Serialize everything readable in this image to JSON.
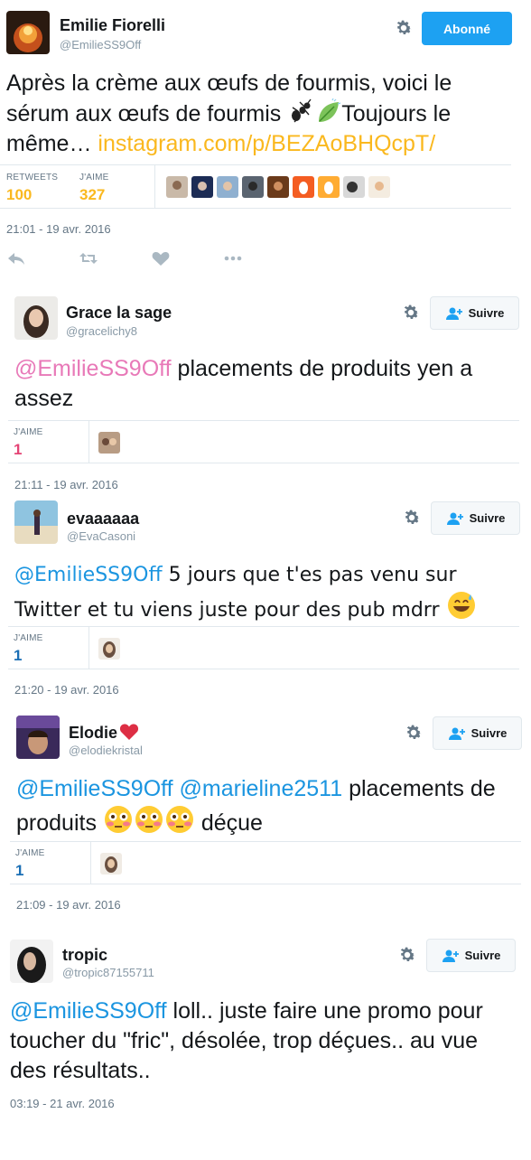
{
  "main_tweet": {
    "name": "Emilie Fiorelli",
    "handle": "@EmilieSS9Off",
    "follow_state_label": "Abonné",
    "text_part1": "Après la crème aux œufs de fourmis, voici le sérum aux œufs de fourmis ",
    "text_part2": "Toujours le même… ",
    "link": "instagram.com/p/BEZAoBHQcpT/",
    "retweets_label": "RETWEETS",
    "retweets_count": "100",
    "likes_label": "J'AIME",
    "likes_count": "327",
    "timestamp": "21:01 - 19 avr. 2016",
    "colors": {
      "follow_button": "#1da1f2",
      "link": "#fab81e",
      "stat_value": "#fab81e"
    }
  },
  "replies": [
    {
      "name": "Grace la sage",
      "handle": "@gracelichy8",
      "follow_label": "Suivre",
      "mention": "@EmilieSS9Off",
      "text": " placements de produits yen a assez",
      "likes_label": "J'AIME",
      "likes_count": "1",
      "timestamp": "21:11 - 19 avr. 2016"
    },
    {
      "name": "evaaaaaa",
      "handle": "@EvaCasoni",
      "follow_label": "Suivre",
      "mention": "@EmilieSS9Off",
      "text": " 5 jours que t'es pas venu sur Twitter et tu viens juste pour des pub mdrr ",
      "likes_label": "J'AIME",
      "likes_count": "1",
      "timestamp": "21:20 - 19 avr. 2016"
    },
    {
      "name": "Elodie",
      "handle": "@elodiekristal",
      "follow_label": "Suivre",
      "mention": "@EmilieSS9Off",
      "mention2": "@marieline2511",
      "text": " placements de produits ",
      "text_end": " déçue",
      "likes_label": "J'AIME",
      "likes_count": "1",
      "timestamp": "21:09 - 19 avr. 2016"
    },
    {
      "name": "tropic",
      "handle": "@tropic87155711",
      "follow_label": "Suivre",
      "mention": "@EmilieSS9Off",
      "text": " loll.. juste faire une promo pour toucher du \"fric\", désolée, trop déçues.. au vue des résultats..",
      "timestamp": "03:19 - 21 avr. 2016"
    }
  ]
}
